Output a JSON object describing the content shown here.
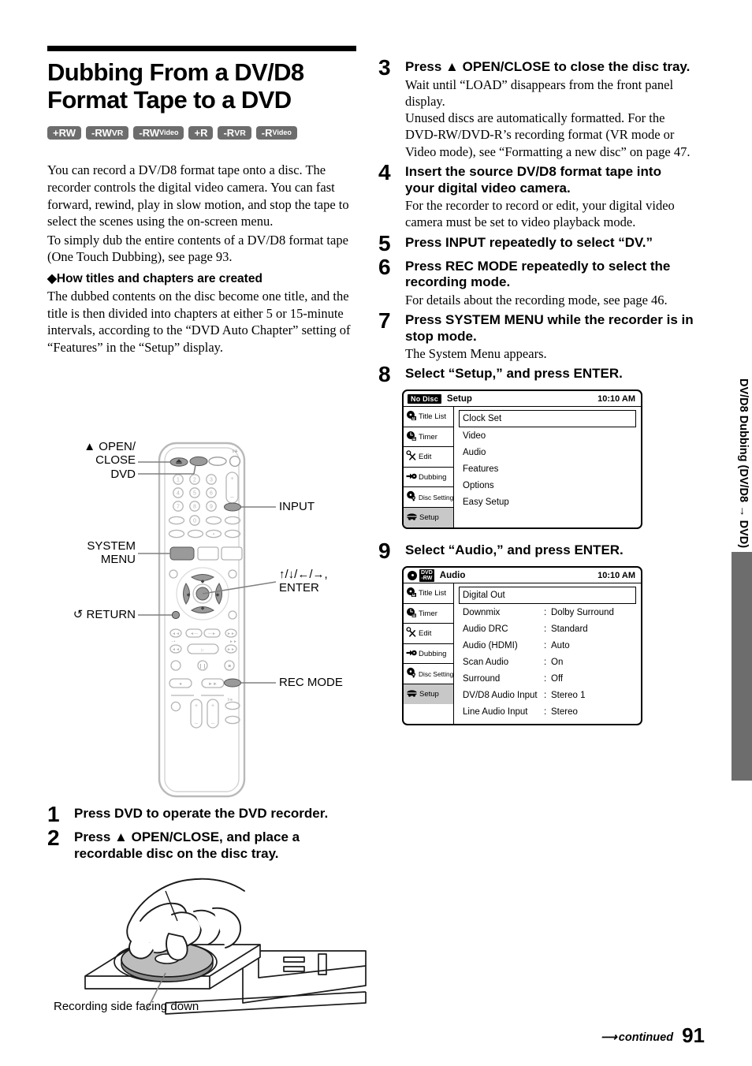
{
  "document": {
    "title": "Dubbing From a DV/D8 Format Tape to a DVD",
    "page_number": "91",
    "continued_label": "continued",
    "side_tab_label": "DV/D8 Dubbing (DV/D8 → DVD)"
  },
  "disc_badges": [
    {
      "prefix": "+RW",
      "suffix": ""
    },
    {
      "prefix": "-RW",
      "suffix": "VR"
    },
    {
      "prefix": "-RW",
      "suffix": "Video"
    },
    {
      "prefix": "+R",
      "suffix": ""
    },
    {
      "prefix": "-R",
      "suffix": "VR"
    },
    {
      "prefix": "-R",
      "suffix": "Video"
    }
  ],
  "intro": {
    "p1": "You can record a DV/D8 format tape onto a disc. The recorder controls the digital video camera. You can fast forward, rewind, play in slow motion, and stop the tape to select the scenes using the on-screen menu.",
    "p2": "To simply dub the entire contents of a DV/D8 format tape (One Touch Dubbing), see page 93.",
    "subhead": "◆How titles and chapters are created",
    "p3": "The dubbed contents on the disc become one title, and the title is then divided into chapters at either 5 or 15-minute intervals, according to the “DVD Auto Chapter” setting of “Features” in the “Setup” display."
  },
  "remote_labels": {
    "open_close_line1": "▲ OPEN/",
    "open_close_line2": "CLOSE",
    "dvd": "DVD",
    "system": "SYSTEM",
    "menu": "MENU",
    "return": "RETURN",
    "input": "INPUT",
    "arrows": "↑/↓/←/→,",
    "enter": "ENTER",
    "rec_mode": "REC MODE"
  },
  "tray": {
    "caption": "Recording side facing down"
  },
  "steps": [
    {
      "num": "1",
      "head": "Press DVD to operate the DVD recorder.",
      "sub": ""
    },
    {
      "num": "2",
      "head": "Press ▲ OPEN/CLOSE, and place a recordable disc on the disc tray.",
      "sub": ""
    },
    {
      "num": "3",
      "head": "Press ▲ OPEN/CLOSE to close the disc tray.",
      "sub": "Wait until “LOAD” disappears from the front panel display.\nUnused discs are automatically formatted. For the DVD-RW/DVD-R’s recording format (VR mode or Video mode), see “Formatting a new disc” on page 47."
    },
    {
      "num": "4",
      "head": "Insert the source DV/D8 format tape into your digital video camera.",
      "sub": "For the recorder to record or edit, your digital video camera must be set to video playback mode."
    },
    {
      "num": "5",
      "head": "Press INPUT repeatedly to select “DV.”",
      "sub": ""
    },
    {
      "num": "6",
      "head": "Press REC MODE repeatedly to select the recording mode.",
      "sub": "For details about the recording mode, see page 46."
    },
    {
      "num": "7",
      "head": "Press SYSTEM MENU while the recorder is in stop mode.",
      "sub": "The System Menu appears."
    },
    {
      "num": "8",
      "head": "Select “Setup,” and press ENTER.",
      "sub": ""
    },
    {
      "num": "9",
      "head": "Select “Audio,” and press ENTER.",
      "sub": ""
    }
  ],
  "osd_sidebar": [
    {
      "label": "Title List",
      "icon": "title-list-icon",
      "selected": false,
      "small": false
    },
    {
      "label": "Timer",
      "icon": "timer-icon",
      "selected": false,
      "small": false
    },
    {
      "label": "Edit",
      "icon": "edit-scissors-icon",
      "selected": false,
      "small": false
    },
    {
      "label": "Dubbing",
      "icon": "dubbing-arrow-icon",
      "selected": false,
      "small": false
    },
    {
      "label": "Disc Setting",
      "icon": "disc-setting-icon",
      "selected": false,
      "small": true
    },
    {
      "label": "Setup",
      "icon": "setup-icon",
      "selected": true,
      "small": false
    }
  ],
  "osd_setup": {
    "disc_badge": "No Disc",
    "title": "Setup",
    "clock": "10:10 AM",
    "rows": [
      {
        "key": "Clock Set",
        "value": "",
        "highlighted": true
      },
      {
        "key": "Video",
        "value": "",
        "highlighted": false
      },
      {
        "key": "Audio",
        "value": "",
        "highlighted": false
      },
      {
        "key": "Features",
        "value": "",
        "highlighted": false
      },
      {
        "key": "Options",
        "value": "",
        "highlighted": false
      },
      {
        "key": "Easy Setup",
        "value": "",
        "highlighted": false
      }
    ]
  },
  "osd_audio": {
    "disc_badge_line1": "DVD",
    "disc_badge_line2": "-RW",
    "title": "Audio",
    "clock": "10:10 AM",
    "rows": [
      {
        "key": "Digital Out",
        "value": "",
        "highlighted": true
      },
      {
        "key": "Downmix",
        "value": "Dolby Surround",
        "highlighted": false
      },
      {
        "key": "Audio DRC",
        "value": "Standard",
        "highlighted": false
      },
      {
        "key": "Audio (HDMI)",
        "value": "Auto",
        "highlighted": false
      },
      {
        "key": "Scan Audio",
        "value": "On",
        "highlighted": false
      },
      {
        "key": "Surround",
        "value": "Off",
        "highlighted": false
      },
      {
        "key": "DV/D8 Audio Input",
        "value": "Stereo 1",
        "highlighted": false
      },
      {
        "key": "Line Audio Input",
        "value": "Stereo",
        "highlighted": false
      }
    ]
  },
  "colors": {
    "badge_gray": "#6d6d6d",
    "osd_selected_gray": "#c8c8c8",
    "remote_button_gray": "#9a9a9a"
  }
}
